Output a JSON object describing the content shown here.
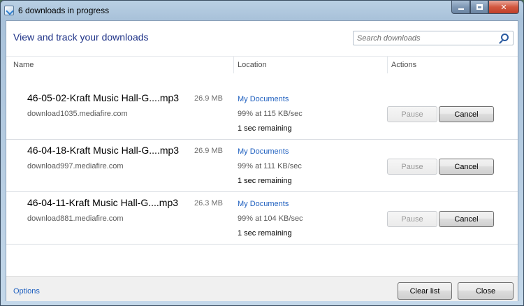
{
  "window": {
    "title": "6 downloads in progress"
  },
  "header": {
    "title": "View and track your downloads",
    "search_placeholder": "Search downloads"
  },
  "columns": {
    "name": "Name",
    "location": "Location",
    "actions": "Actions"
  },
  "downloads": [
    {
      "filename": "46-05-02-Kraft Music Hall-G....mp3",
      "size": "26.9 MB",
      "source": "download1035.mediafire.com",
      "location": "My Documents",
      "progress": "99% at 115 KB/sec",
      "remaining": "1 sec remaining",
      "pause_label": "Pause",
      "cancel_label": "Cancel"
    },
    {
      "filename": "46-04-18-Kraft Music Hall-G....mp3",
      "size": "26.9 MB",
      "source": "download997.mediafire.com",
      "location": "My Documents",
      "progress": "99% at 111 KB/sec",
      "remaining": "1 sec remaining",
      "pause_label": "Pause",
      "cancel_label": "Cancel"
    },
    {
      "filename": "46-04-11-Kraft Music Hall-G....mp3",
      "size": "26.3 MB",
      "source": "download881.mediafire.com",
      "location": "My Documents",
      "progress": "99% at 104 KB/sec",
      "remaining": "1 sec remaining",
      "pause_label": "Pause",
      "cancel_label": "Cancel"
    }
  ],
  "footer": {
    "options_label": "Options",
    "clear_list_label": "Clear list",
    "close_label": "Close"
  }
}
